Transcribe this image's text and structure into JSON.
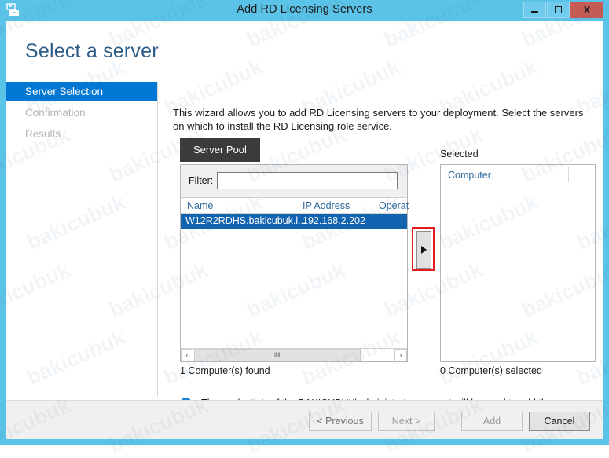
{
  "window": {
    "title": "Add RD Licensing Servers",
    "icon": "server-wizard-icon",
    "minimize_label": "",
    "maximize_label": "",
    "close_label": "X",
    "frame_color": "#5CC3E8",
    "close_color": "#c75b53"
  },
  "page": {
    "heading": "Select a server",
    "intro": "This wizard allows you to add RD Licensing servers to your deployment. Select the servers on which to install the RD Licensing role service."
  },
  "nav": {
    "items": [
      {
        "label": "Server Selection",
        "active": true
      },
      {
        "label": "Confirmation",
        "active": false
      },
      {
        "label": "Results",
        "active": false
      }
    ],
    "active_color": "#0078D4"
  },
  "tabs": [
    {
      "label": "Server Pool",
      "selected": true
    }
  ],
  "filter": {
    "label": "Filter:",
    "value": "",
    "placeholder": ""
  },
  "pool_table": {
    "columns": [
      "Name",
      "IP Address",
      "Operat"
    ],
    "rows": [
      {
        "name": "W12R2RDHS.bakicubuk.l...",
        "ip": "192.168.2.202",
        "os": "",
        "selected": true
      }
    ],
    "status": "1 Computer(s) found",
    "scrollbar": {
      "left_arrow": "‹",
      "right_arrow": "›",
      "grip": "‖‖"
    }
  },
  "transfer_button": {
    "glyph": "right-triangle",
    "highlight_color": "#e01b1b"
  },
  "selected_panel": {
    "label": "Selected",
    "column": "Computer",
    "items": [],
    "status": "0 Computer(s) selected"
  },
  "info": {
    "icon": "info-icon",
    "glyph": "i",
    "text": "The credentials of the BAKICUBUK\\administrator account will be used to add the servers."
  },
  "footer": {
    "buttons": [
      {
        "label": "< Previous",
        "enabled": true
      },
      {
        "label": "Next >",
        "enabled": false
      },
      {
        "label": "Add",
        "enabled": false
      },
      {
        "label": "Cancel",
        "enabled": true
      }
    ]
  },
  "watermark": {
    "text": "bakicubuk"
  }
}
